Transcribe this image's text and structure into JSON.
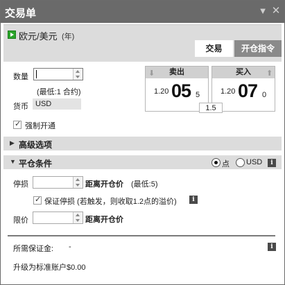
{
  "window": {
    "title": "交易单",
    "minimize_glyph": "▼",
    "close_glyph": "✕"
  },
  "symbol": {
    "name": "欧元/美元",
    "tag": "(年)",
    "play_icon_color": "#2aa52a"
  },
  "tabs": [
    {
      "label": "交易",
      "active": true
    },
    {
      "label": "开仓指令",
      "active": false
    }
  ],
  "order": {
    "quantity_label": "数量",
    "quantity_value": "",
    "min_hint": "(最低:1 合约)",
    "currency_label": "货币",
    "currency_value": "USD"
  },
  "quotes": {
    "sell": {
      "label": "卖出",
      "prefix": "1.20",
      "big": "05",
      "small": "5"
    },
    "buy": {
      "label": "买入",
      "prefix": "1.20",
      "big": "07",
      "small": "0"
    },
    "spread": "1.5"
  },
  "force_open": {
    "label": "强制开通",
    "checked": true
  },
  "advanced": {
    "title": "高级选项",
    "expanded": false
  },
  "close_conditions": {
    "title": "平仓条件",
    "expanded": true,
    "unit_options": [
      {
        "label": "点",
        "selected": true
      },
      {
        "label": "USD",
        "selected": false
      }
    ],
    "info_glyph": "i",
    "stop_loss": {
      "label": "停损",
      "value": "",
      "distance_label": "距离开仓价",
      "min_hint": "(最低:5)"
    },
    "guaranteed_stop": {
      "label": "保证停损 (若触发，则收取1.2点的溢价)",
      "checked": true
    },
    "limit": {
      "label": "限价",
      "value": "",
      "distance_label": "距离开仓价"
    }
  },
  "footer": {
    "margin_label": "所需保证金:",
    "margin_value": "-",
    "upgrade_text": "升级为标准账户$0.00"
  }
}
